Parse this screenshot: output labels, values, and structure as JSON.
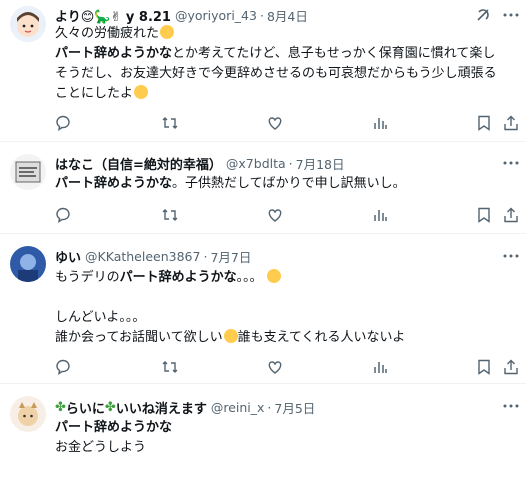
{
  "tweets": [
    {
      "name": "より😊🦕✌ y 8.21",
      "handle": "@yoriyori_43",
      "date": "8月4日",
      "lines": [
        {
          "pre": "久々の労働疲れた",
          "b": "",
          "post": ""
        },
        {
          "pre": "",
          "b": "パート辞めようかな",
          "post": "とか考えてたけど、息子もせっかく保育園に慣れて楽し"
        },
        {
          "pre": "そうだし、お友達大好きで今更辞めさせるのも可哀想だからもう少し頑張る",
          "b": "",
          "post": ""
        },
        {
          "pre": "ことにしたよ",
          "b": "",
          "post": ""
        }
      ]
    },
    {
      "name": "はなこ（自信=絶対的幸福）",
      "handle": "@x7bdlta",
      "date": "7月18日",
      "lines": [
        {
          "pre": "",
          "b": "パート辞めようかな",
          "post": "。子供熱だしてばかりで申し訳無いし。"
        }
      ]
    },
    {
      "name": "ゆい",
      "handle": "@KKatheleen3867",
      "date": "7月7日",
      "lines": [
        {
          "pre": "もうデリの",
          "b": "パート辞めようかな",
          "post": "。。。"
        },
        {
          "pre": "",
          "b": "",
          "post": ""
        },
        {
          "pre": "しんどいよ。。。",
          "b": "",
          "post": ""
        },
        {
          "pre": "誰か会ってお話聞いて欲しい",
          "b": "",
          "post": "誰も支えてくれる人いないよ"
        }
      ]
    },
    {
      "name_pre": "らいに",
      "name_post": "いいね消えます",
      "handle": "@reini_x",
      "date": "7月5日",
      "lines": [
        {
          "pre": "",
          "b": "パート辞めようかな",
          "post": ""
        },
        {
          "pre": "お金どうしよう",
          "b": "",
          "post": ""
        }
      ]
    }
  ],
  "dot": "·",
  "icons": [
    "reply-icon",
    "retweet-icon",
    "like-icon",
    "views-icon",
    "bookmark-icon",
    "share-icon",
    "grok-icon",
    "more-icon"
  ],
  "colors": {
    "text": "#0f1419",
    "secondary": "#536471",
    "divider": "#eff3f4"
  }
}
